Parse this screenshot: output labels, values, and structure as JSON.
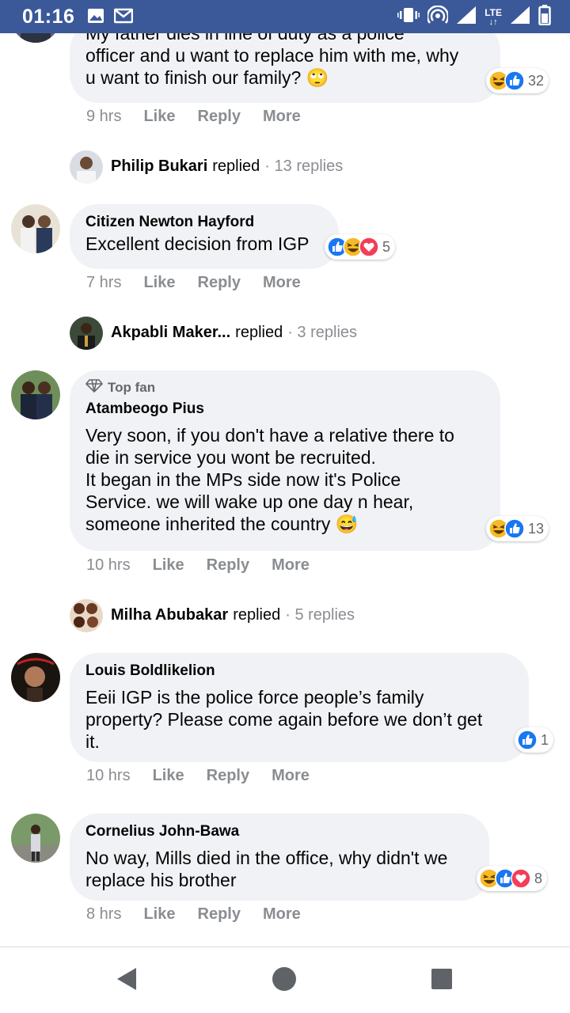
{
  "status_bar": {
    "time": "01:16",
    "network": "LTE"
  },
  "comments": [
    {
      "author": "",
      "text_lines": [
        "My father dies in line of duty as a police",
        "officer and u want to replace him with me, why",
        "u want to finish our family? 🙄"
      ],
      "reactions": {
        "icons": [
          "haha",
          "like"
        ],
        "count": "32"
      },
      "time": "9 hrs"
    },
    {
      "author": "Citizen Newton Hayford",
      "text_lines": [
        "Excellent decision from IGP"
      ],
      "reactions": {
        "icons": [
          "like",
          "haha",
          "love"
        ],
        "count": "5"
      },
      "time": "7 hrs"
    },
    {
      "badge": "Top fan",
      "author": "Atambeogo Pius",
      "text_lines": [
        "Very soon, if you don't have a relative there to",
        "die in service you wont be recruited.",
        "It began in the MPs side now it's Police",
        "Service. we will wake up one day n hear,",
        "someone inherited the country 😅"
      ],
      "reactions": {
        "icons": [
          "haha",
          "like"
        ],
        "count": "13"
      },
      "time": "10 hrs"
    },
    {
      "author": "Louis Boldlikelion",
      "text_lines": [
        "Eeii IGP is the police force people’s family",
        "property? Please come again before we don’t get",
        "it."
      ],
      "reactions": {
        "icons": [
          "like"
        ],
        "count": "1"
      },
      "time": "10 hrs"
    },
    {
      "author": "Cornelius John-Bawa",
      "text_lines": [
        "No way, Mills died in the office, why didn't we",
        "replace his brother"
      ],
      "reactions": {
        "icons": [
          "haha",
          "like",
          "love"
        ],
        "count": "8"
      },
      "time": "8 hrs"
    }
  ],
  "replies": [
    {
      "name": "Philip Bukari",
      "word": "replied",
      "count": "· 13 replies"
    },
    {
      "name": "Akpabli Maker...",
      "word": "replied",
      "count": "· 3 replies"
    },
    {
      "name": "Milha Abubakar",
      "word": "replied",
      "count": "· 5 replies"
    }
  ],
  "actions": {
    "like": "Like",
    "reply": "Reply",
    "more": "More"
  },
  "colors": {
    "status_bar": "#3b5998",
    "bubble": "#f0f2f5",
    "like_blue": "#1877f2",
    "love_red": "#f33e58",
    "haha_yellow": "#f7b928",
    "meta_gray": "#8a8d91"
  }
}
